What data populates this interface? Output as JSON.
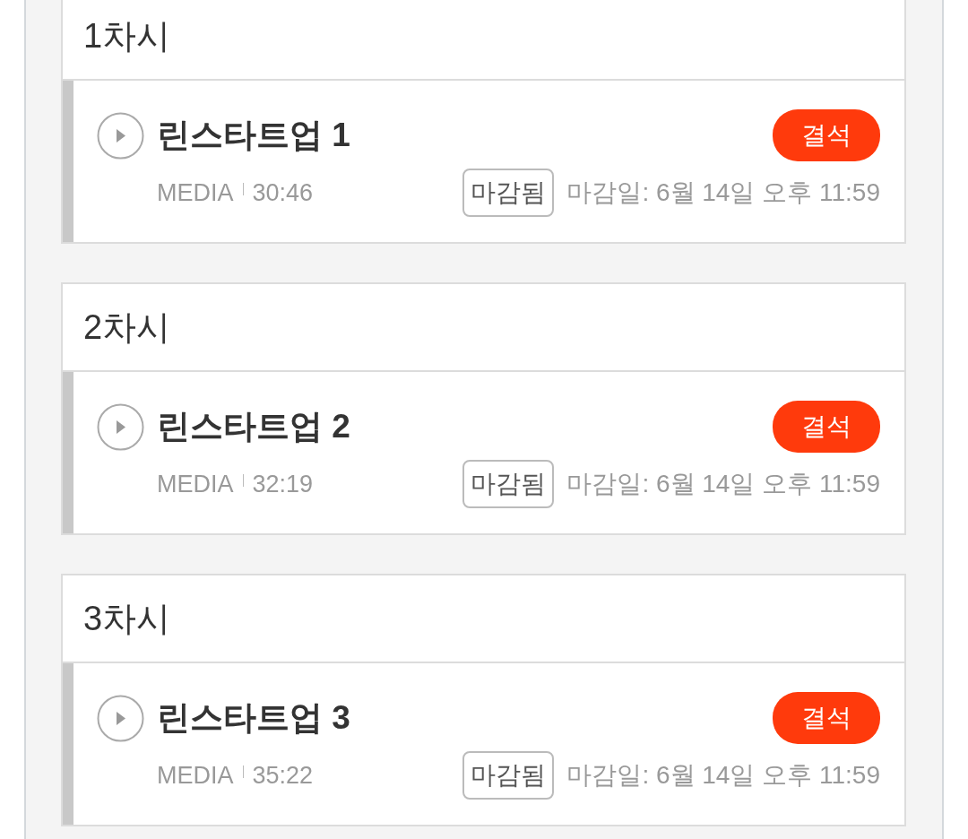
{
  "sessions": [
    {
      "heading": "1차시",
      "lesson": {
        "title": "린스타트업 1",
        "type": "MEDIA",
        "duration": "30:46",
        "attendance": "결석",
        "status": "마감됨",
        "deadline": "마감일: 6월 14일 오후 11:59"
      }
    },
    {
      "heading": "2차시",
      "lesson": {
        "title": "린스타트업 2",
        "type": "MEDIA",
        "duration": "32:19",
        "attendance": "결석",
        "status": "마감됨",
        "deadline": "마감일: 6월 14일 오후 11:59"
      }
    },
    {
      "heading": "3차시",
      "lesson": {
        "title": "린스타트업 3",
        "type": "MEDIA",
        "duration": "35:22",
        "attendance": "결석",
        "status": "마감됨",
        "deadline": "마감일: 6월 14일 오후 11:59"
      }
    }
  ]
}
